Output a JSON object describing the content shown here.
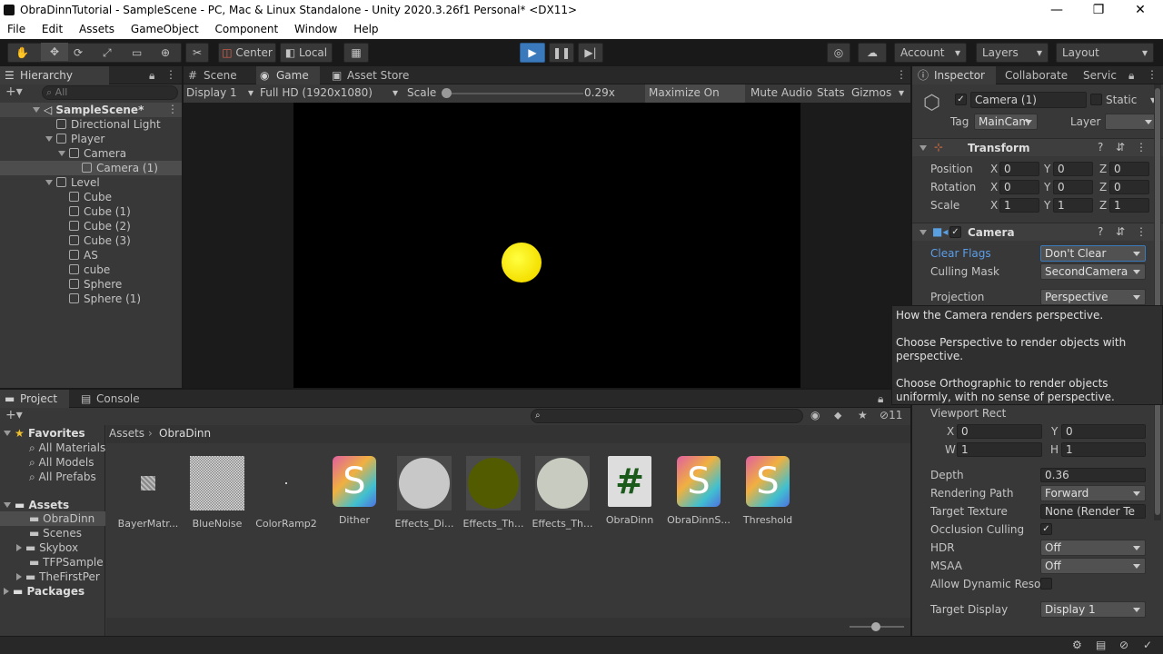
{
  "window": {
    "title": "ObraDinnTutorial - SampleScene - PC, Mac & Linux Standalone - Unity 2020.3.26f1 Personal* <DX11>",
    "minimize": "—",
    "maximize": "❐",
    "close": "✕"
  },
  "menu": [
    "File",
    "Edit",
    "Assets",
    "GameObject",
    "Component",
    "Window",
    "Help"
  ],
  "toolbar": {
    "center": "Center",
    "local": "Local",
    "account": "Account",
    "layers": "Layers",
    "layout": "Layout"
  },
  "hierarchy": {
    "tab": "Hierarchy",
    "search_placeholder": "All",
    "scene": "SampleScene*",
    "items": [
      "Directional Light",
      "Player",
      "Camera",
      "Camera (1)",
      "Level",
      "Cube",
      "Cube (1)",
      "Cube (2)",
      "Cube (3)",
      "AS",
      "cube",
      "Sphere",
      "Sphere (1)"
    ]
  },
  "game": {
    "tabs": [
      "Scene",
      "Game",
      "Asset Store"
    ],
    "display": "Display 1",
    "resolution": "Full HD (1920x1080)",
    "scale_label": "Scale",
    "scale_value": "0.29x",
    "maximize": "Maximize On Play",
    "mute": "Mute Audio",
    "stats": "Stats",
    "gizmos": "Gizmos"
  },
  "project": {
    "tabs": [
      "Project",
      "Console"
    ],
    "favorites_label": "Favorites",
    "favorites": [
      "All Materials",
      "All Models",
      "All Prefabs"
    ],
    "assets_label": "Assets",
    "folders": [
      "ObraDinn",
      "Scenes",
      "Skybox",
      "TFPSample",
      "TheFirstPer"
    ],
    "packages": "Packages",
    "breadcrumb": [
      "Assets",
      "ObraDinn"
    ],
    "hidden_count": "11",
    "asset_items": [
      "BayerMatr...",
      "BlueNoise",
      "ColorRamp2",
      "Dither",
      "Effects_Di...",
      "Effects_Th...",
      "Effects_Th...",
      "ObraDinn",
      "ObraDinnS...",
      "Threshold"
    ]
  },
  "inspector": {
    "tabs": [
      "Inspector",
      "Collaborate",
      "Servic"
    ],
    "object_name": "Camera (1)",
    "static": "Static",
    "tag_label": "Tag",
    "tag": "MainCam",
    "layer_label": "Layer",
    "transform": {
      "header": "Transform",
      "rows": [
        {
          "label": "Position",
          "x": "0",
          "y": "0",
          "z": "0"
        },
        {
          "label": "Rotation",
          "x": "0",
          "y": "0",
          "z": "0"
        },
        {
          "label": "Scale",
          "x": "1",
          "y": "1",
          "z": "1"
        }
      ],
      "axis": [
        "X",
        "Y",
        "Z"
      ]
    },
    "camera": {
      "header": "Camera",
      "clear_flags_label": "Clear Flags",
      "clear_flags": "Don't Clear",
      "culling_label": "Culling Mask",
      "culling": "SecondCamera",
      "projection_label": "Projection",
      "projection": "Perspective",
      "viewport_label": "Viewport Rect",
      "vx": "0",
      "vy": "0",
      "vw": "1",
      "vh": "1",
      "x_label": "X",
      "y_label": "Y",
      "w_label": "W",
      "h_label": "H",
      "depth_label": "Depth",
      "depth": "0.36",
      "rendering_label": "Rendering Path",
      "rendering": "Forward",
      "target_tex_label": "Target Texture",
      "target_tex": "None (Render Te",
      "occlusion_label": "Occlusion Culling",
      "hdr_label": "HDR",
      "hdr": "Off",
      "msaa_label": "MSAA",
      "msaa": "Off",
      "dyn_label": "Allow Dynamic Resol",
      "target_display_label": "Target Display",
      "target_display": "Display 1"
    },
    "tooltip": [
      "How the Camera renders perspective.",
      "Choose Perspective to render objects with perspective.",
      "Choose Orthographic to render objects uniformly, with no sense of perspective."
    ]
  },
  "colors": {
    "accent": "#3a79bb",
    "sphere": "#ffff00",
    "selection": "#2c5d87"
  }
}
